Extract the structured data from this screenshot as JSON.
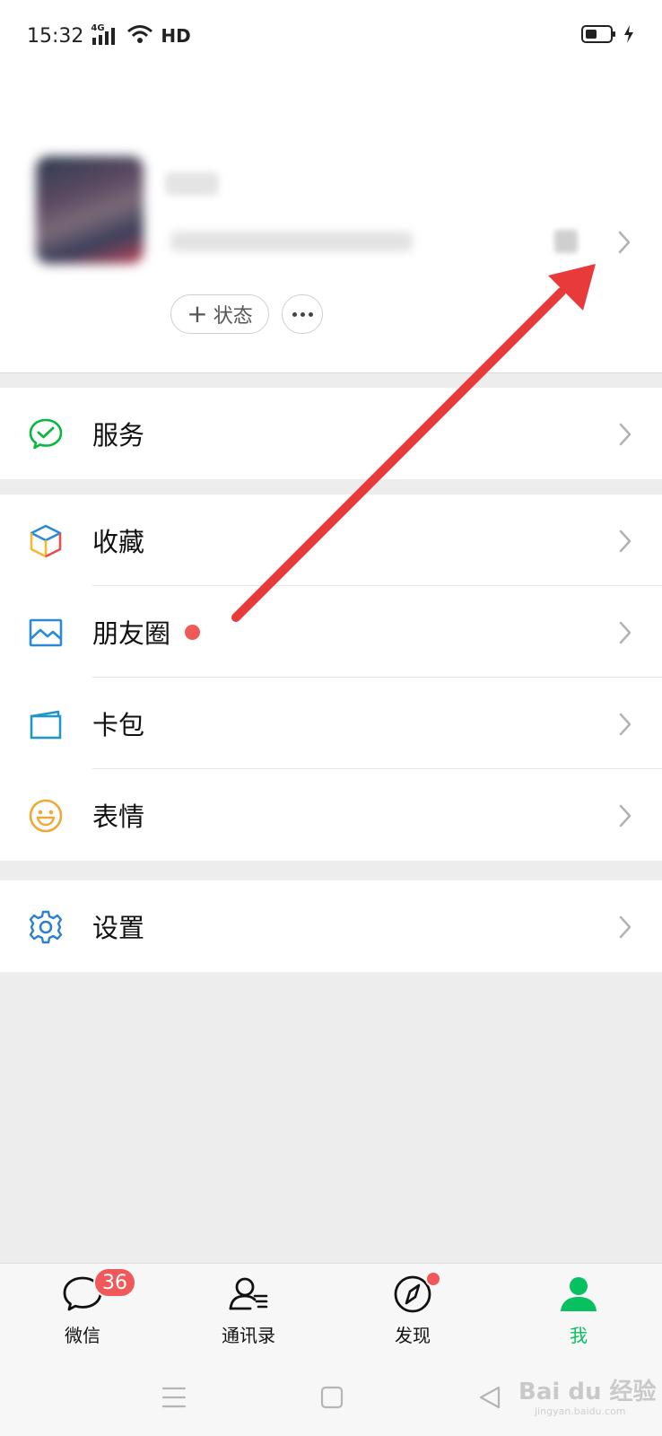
{
  "status_bar": {
    "time": "15:32",
    "network": "4G",
    "hd": "HD"
  },
  "profile": {
    "status_button_label": "状态",
    "status_button_plus": "+"
  },
  "menu": {
    "services": {
      "label": "服务",
      "icon": "wechat-pay-icon"
    },
    "favorites": {
      "label": "收藏",
      "icon": "cube-icon"
    },
    "moments": {
      "label": "朋友圈",
      "icon": "image-icon",
      "has_dot": true
    },
    "cards": {
      "label": "卡包",
      "icon": "card-icon"
    },
    "stickers": {
      "label": "表情",
      "icon": "smiley-icon"
    },
    "settings": {
      "label": "设置",
      "icon": "gear-icon"
    }
  },
  "tabbar": {
    "chats": {
      "label": "微信",
      "badge": "36"
    },
    "contacts": {
      "label": "通讯录"
    },
    "discover": {
      "label": "发现",
      "has_dot": true
    },
    "me": {
      "label": "我",
      "active": true
    }
  },
  "watermark": {
    "text": "Bai du 经验",
    "sub": "jingyan.baidu.com"
  },
  "colors": {
    "accent_green": "#07c160",
    "badge_red": "#f0595a",
    "annotation_red": "#e83a3a",
    "background": "#ededed"
  }
}
